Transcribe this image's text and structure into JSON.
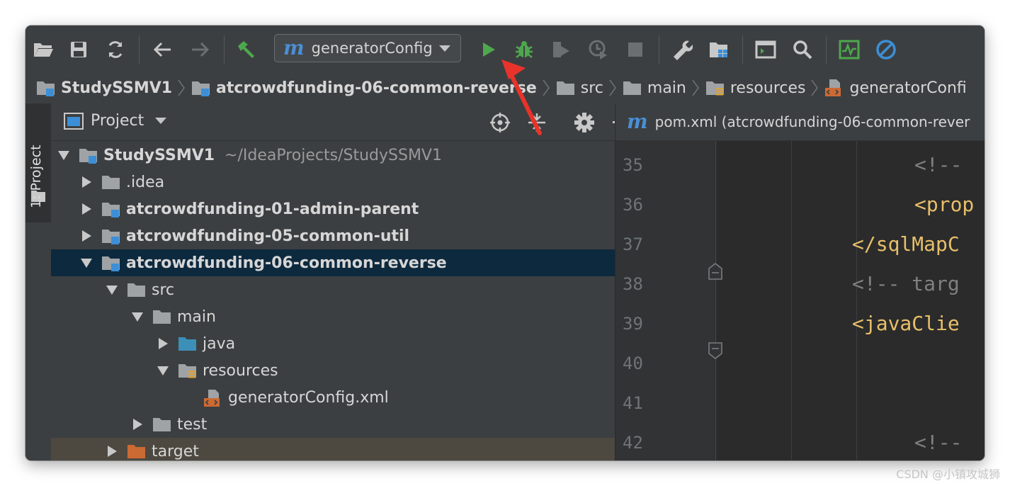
{
  "toolbar": {
    "run_config_label": "generatorConfig",
    "run_config_icon": "maven-m-icon"
  },
  "breadcrumb": [
    {
      "label": "StudySSMV1",
      "bold": true
    },
    {
      "label": "atcrowdfunding-06-common-reverse",
      "bold": true
    },
    {
      "label": "src",
      "bold": false
    },
    {
      "label": "main",
      "bold": false
    },
    {
      "label": "resources",
      "bold": false
    },
    {
      "label": "generatorConfi",
      "bold": false
    }
  ],
  "stripe": {
    "tab_label": "1: Project"
  },
  "project_panel": {
    "title": "Project",
    "tree": [
      {
        "name": "StudySSMV1",
        "path": "~/IdeaProjects/StudySSMV1"
      },
      {
        "name": ".idea"
      },
      {
        "name": "atcrowdfunding-01-admin-parent"
      },
      {
        "name": "atcrowdfunding-05-common-util"
      },
      {
        "name": "atcrowdfunding-06-common-reverse"
      },
      {
        "name": "src"
      },
      {
        "name": "main"
      },
      {
        "name": "java"
      },
      {
        "name": "resources"
      },
      {
        "name": "generatorConfig.xml"
      },
      {
        "name": "test"
      },
      {
        "name": "target"
      }
    ]
  },
  "editor": {
    "tab_label": "pom.xml (atcrowdfunding-06-common-rever",
    "line_numbers": [
      "35",
      "36",
      "37",
      "38",
      "39",
      "40",
      "41",
      "42"
    ],
    "lines": [
      "<!-- ",
      "<prop",
      "</sqlMapC",
      "<!-- targ",
      "<javaClie",
      "",
      "",
      "<!-- "
    ]
  },
  "colors": {
    "window_bg": "#3c3f41",
    "editor_bg": "#2b2b2b",
    "selected_row": "#0d293e",
    "xml_tag": "#e8bf6a",
    "comment": "#808080",
    "run_green": "#4ea74e",
    "annotation_arrow": "#e8332a"
  },
  "watermark": "CSDN @小镇攻城狮"
}
